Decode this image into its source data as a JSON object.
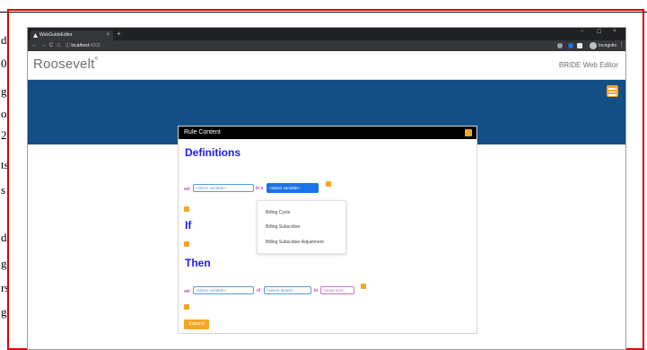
{
  "background": {
    "edge_glyphs": [
      "d",
      "0",
      "g",
      "o",
      "2",
      "ts",
      "s",
      "d",
      "g",
      "rs",
      "g"
    ]
  },
  "browser": {
    "tab_title": "WebGuideEditor",
    "tab_close": "×",
    "new_tab": "+",
    "window_controls": [
      "−",
      "☐",
      "×"
    ],
    "nav": {
      "back": "←",
      "forward": "→",
      "reload": "C",
      "home": "⌂"
    },
    "url_icon": "ⓘ",
    "url_host": "localhost",
    "url_port": ":4200",
    "profile_label": "Incognito",
    "menu": "⋮",
    "colors": {
      "tabbar": "#202124",
      "toolbar": "#35363a"
    }
  },
  "app": {
    "logo": "Roosevelt",
    "logo_mark": "®",
    "title": "BRIDE Web Editor",
    "colors": {
      "band": "#134f86",
      "accent": "#f5a623"
    }
  },
  "panel": {
    "header": "Rule Content",
    "definitions_title": "Definitions",
    "if_title": "If",
    "then_title": "Then",
    "def_row": {
      "set_kw": "set",
      "variable_select": "<select variable>",
      "to_kw": "to a",
      "variable_select_active": "<select variable>"
    },
    "dropdown_options": [
      "Billing Cycle",
      "Billing Subscriber",
      "Billing Subscriber Adjustment"
    ],
    "then_row": {
      "set_kw": "set",
      "variable_select": "<select variable>",
      "of_kw": "of",
      "target_select": "<select target>",
      "to_kw": "to",
      "text_placeholder": "<enter text>"
    },
    "expand_label": "Expand"
  }
}
